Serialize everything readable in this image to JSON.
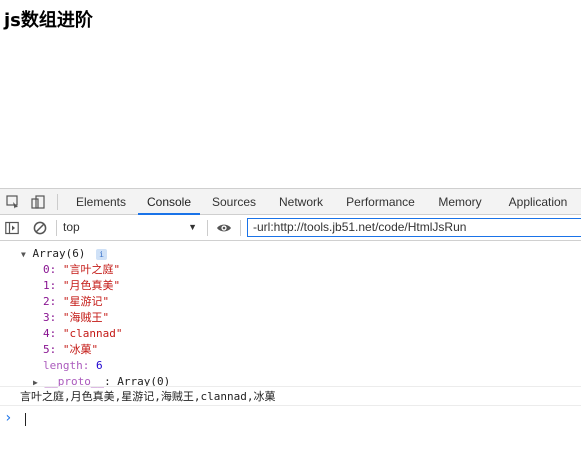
{
  "page": {
    "title": "js数组进阶"
  },
  "devtools": {
    "tabs": [
      {
        "label": "Elements",
        "active": false
      },
      {
        "label": "Console",
        "active": true
      },
      {
        "label": "Sources",
        "active": false
      },
      {
        "label": "Network",
        "active": false
      },
      {
        "label": "Performance",
        "active": false
      },
      {
        "label": "Memory",
        "active": false
      },
      {
        "label": "Application",
        "active": false
      }
    ],
    "toolbar": {
      "context": "top",
      "filter_value": "-url:http://tools.jb51.net/code/HtmlJsRun"
    },
    "console": {
      "array_header": "Array(6)",
      "info_badge": "i",
      "items": [
        {
          "index": "0:",
          "value": "\"言叶之庭\""
        },
        {
          "index": "1:",
          "value": "\"月色真美\""
        },
        {
          "index": "2:",
          "value": "\"星游记\""
        },
        {
          "index": "3:",
          "value": "\"海贼王\""
        },
        {
          "index": "4:",
          "value": "\"clannad\""
        },
        {
          "index": "5:",
          "value": "\"冰菓\""
        }
      ],
      "length_key": "length:",
      "length_value": "6",
      "proto_key": "__proto__",
      "proto_value": ": Array(0)",
      "log_output": "言叶之庭,月色真美,星游记,海贼王,clannad,冰菓",
      "prompt_symbol": "›"
    },
    "colors": {
      "accent": "#1a73e8",
      "string": "#c41a16",
      "key": "#881391",
      "number": "#1c00cf"
    }
  }
}
